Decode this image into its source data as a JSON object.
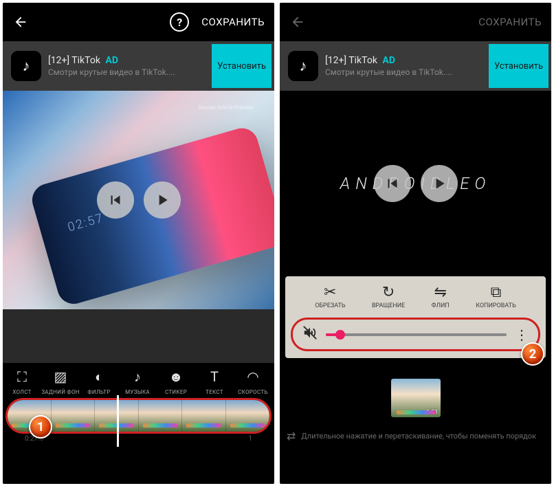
{
  "topbar": {
    "save": "СОХРАНИТЬ",
    "help": "?"
  },
  "ad": {
    "title": "[12+] TikTok",
    "tag": "AD",
    "subtitle": "Смотри крутые видео в TikTok....",
    "install": "Установить"
  },
  "left": {
    "preview_time": "02:57",
    "preview_caption": "Render Article Preview",
    "tools": [
      {
        "icon": "⛶",
        "label": "ХОЛСТ"
      },
      {
        "icon": "▨",
        "label": "ЗАДНИЙ ФОН"
      },
      {
        "icon": "◐",
        "label": "ФИЛЬТР"
      },
      {
        "icon": "♪",
        "label": "МУЗЫКА"
      },
      {
        "icon": "☻",
        "label": "СТИКЕР"
      },
      {
        "icon": "T",
        "label": "ТЕКСТ"
      },
      {
        "icon": "◠",
        "label": "СКОРОСТЬ"
      }
    ],
    "timeline": {
      "start": "0:27.0",
      "end": "1"
    }
  },
  "right": {
    "brand": "ANDROIDLEO",
    "edit_tools": [
      {
        "icon": "✂",
        "label": "ОБРЕЗАТЬ"
      },
      {
        "icon": "↻",
        "label": "ВРАЩЕНИЕ"
      },
      {
        "icon": "⇋",
        "label": "ФЛИП"
      },
      {
        "icon": "⧉",
        "label": "КОПИРОВАТЬ"
      }
    ],
    "volume": {
      "percent": 8
    },
    "clip": {
      "duration": "1:51"
    },
    "hint": "Длительное нажатие и перетаскивание, чтобы поменять порядок"
  },
  "badges": {
    "one": "1",
    "two": "2"
  }
}
